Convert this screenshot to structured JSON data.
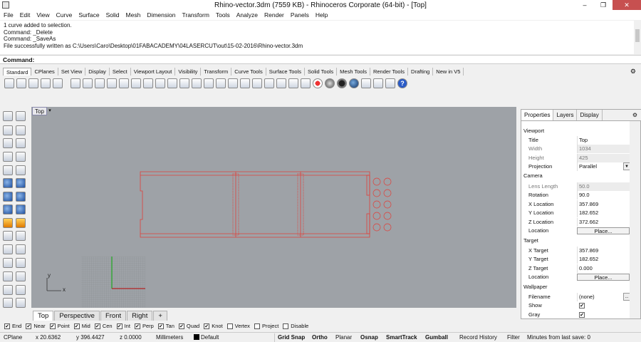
{
  "window": {
    "title": "Rhino-vector.3dm (7559 KB) - Rhinoceros Corporate (64-bit) - [Top]",
    "minimize": "–",
    "maximize": "❐",
    "close": "✕"
  },
  "menu": [
    "File",
    "Edit",
    "View",
    "Curve",
    "Surface",
    "Solid",
    "Mesh",
    "Dimension",
    "Transform",
    "Tools",
    "Analyze",
    "Render",
    "Panels",
    "Help"
  ],
  "history": [
    "1 curve added to selection.",
    "Command: _Delete",
    "Command: _SaveAs",
    "File successfully written as C:\\Users\\Caro\\Desktop\\01FABACADEMY\\04LASERCUT\\out\\15-02-2016\\Rhino-vector.3dm"
  ],
  "command": {
    "label": "Command:",
    "value": ""
  },
  "toolbar_tabs": [
    "Standard",
    "CPlanes",
    "Set View",
    "Display",
    "Select",
    "Viewport Layout",
    "Visibility",
    "Transform",
    "Curve Tools",
    "Surface Tools",
    "Solid Tools",
    "Mesh Tools",
    "Render Tools",
    "Drafting",
    "New in V5"
  ],
  "viewport": {
    "name": "Top",
    "axis_x": "x",
    "axis_y": "y",
    "curve_color": "#e0403a"
  },
  "view_tabs": [
    "Top",
    "Perspective",
    "Front",
    "Right",
    "+"
  ],
  "panel": {
    "tabs": [
      "Properties",
      "Layers",
      "Display"
    ],
    "sections": {
      "viewport": "Viewport",
      "camera": "Camera",
      "target": "Target",
      "wallpaper": "Wallpaper"
    },
    "rows": {
      "title": {
        "k": "Title",
        "v": "Top"
      },
      "width": {
        "k": "Width",
        "v": "1034"
      },
      "height": {
        "k": "Height",
        "v": "425"
      },
      "projection": {
        "k": "Projection",
        "v": "Parallel"
      },
      "lens": {
        "k": "Lens Length",
        "v": "50.0"
      },
      "rotation": {
        "k": "Rotation",
        "v": "90.0"
      },
      "xloc": {
        "k": "X Location",
        "v": "357.869"
      },
      "yloc": {
        "k": "Y Location",
        "v": "182.652"
      },
      "zloc": {
        "k": "Z Location",
        "v": "372.662"
      },
      "loc": {
        "k": "Location",
        "v": "Place..."
      },
      "xt": {
        "k": "X Target",
        "v": "357.869"
      },
      "yt": {
        "k": "Y Target",
        "v": "182.652"
      },
      "zt": {
        "k": "Z Target",
        "v": "0.000"
      },
      "tloc": {
        "k": "Location",
        "v": "Place..."
      },
      "file": {
        "k": "Filename",
        "v": "(none)",
        "btn": "..."
      },
      "show": {
        "k": "Show",
        "v": "✔"
      },
      "gray": {
        "k": "Gray",
        "v": "✔"
      }
    }
  },
  "osnaps": [
    {
      "label": "End",
      "checked": true
    },
    {
      "label": "Near",
      "checked": true
    },
    {
      "label": "Point",
      "checked": true
    },
    {
      "label": "Mid",
      "checked": true
    },
    {
      "label": "Cen",
      "checked": true
    },
    {
      "label": "Int",
      "checked": true
    },
    {
      "label": "Perp",
      "checked": true
    },
    {
      "label": "Tan",
      "checked": true
    },
    {
      "label": "Quad",
      "checked": true
    },
    {
      "label": "Knot",
      "checked": true
    },
    {
      "label": "Vertex",
      "checked": false
    },
    {
      "label": "Project",
      "checked": false
    },
    {
      "label": "Disable",
      "checked": false
    }
  ],
  "status": {
    "cplane": "CPlane",
    "x": "x 20.6362",
    "y": "y 396.4427",
    "z": "z 0.0000",
    "units": "Millimeters",
    "layer": "Default",
    "grid_snap": "Grid Snap",
    "ortho": "Ortho",
    "planar": "Planar",
    "osnap": "Osnap",
    "smarttrack": "SmartTrack",
    "gumball": "Gumball",
    "record": "Record History",
    "filter": "Filter",
    "save": "Minutes from last save: 0"
  }
}
